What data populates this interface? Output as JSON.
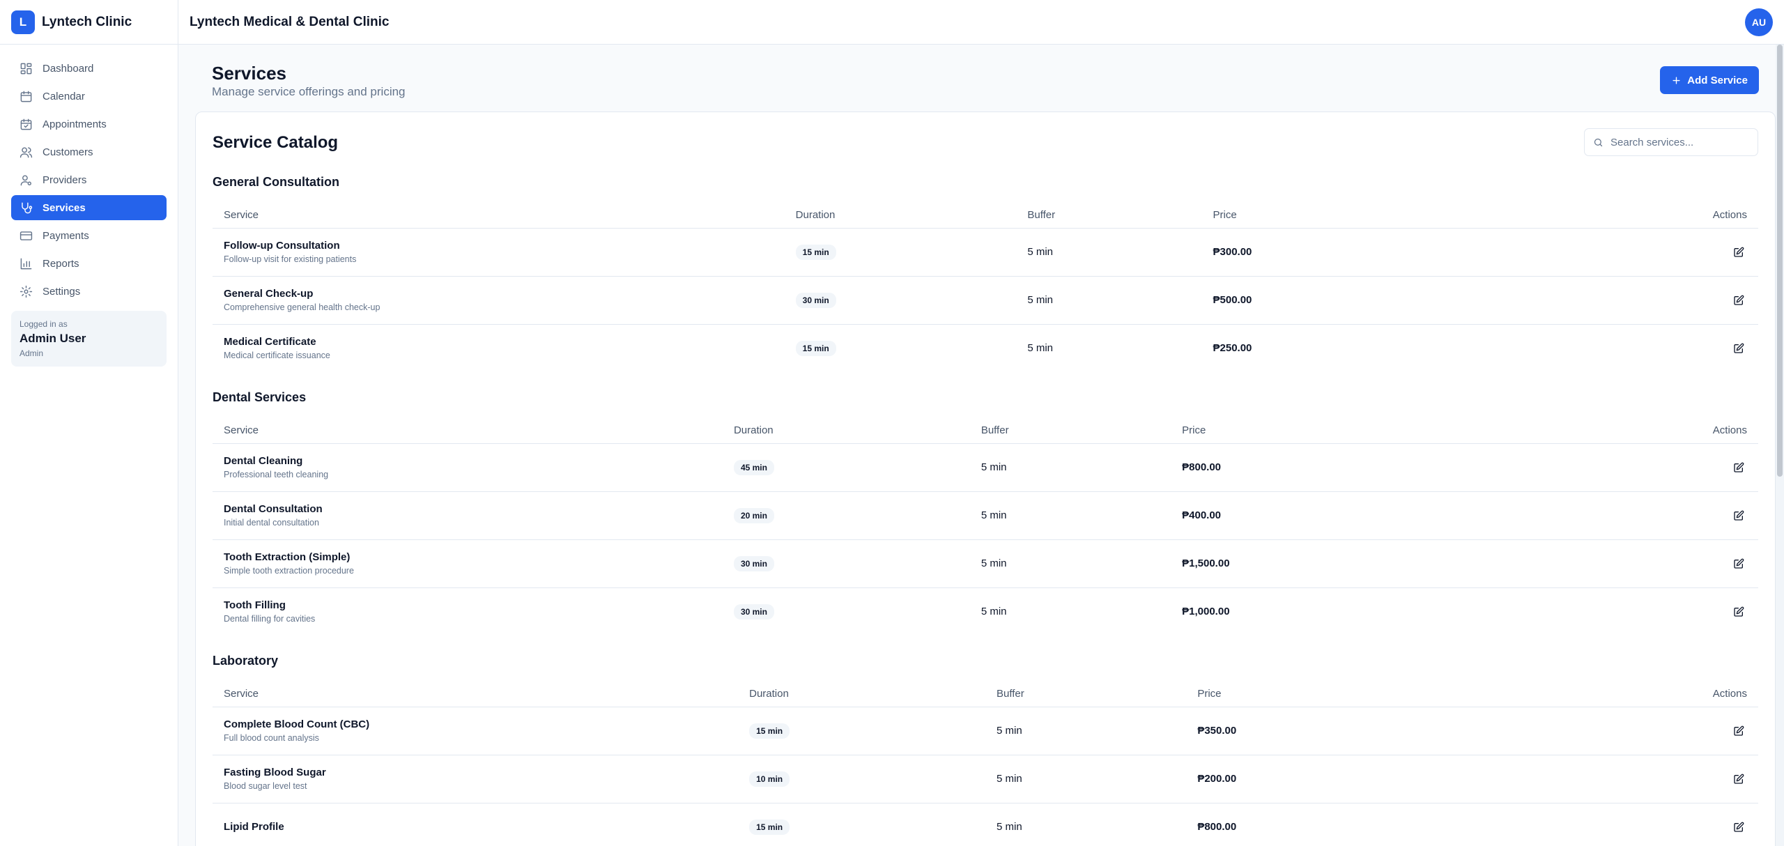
{
  "brand": {
    "logo_letter": "L",
    "name": "Lyntech Clinic"
  },
  "nav": [
    {
      "label": "Dashboard",
      "icon": "dashboard-icon",
      "active": false
    },
    {
      "label": "Calendar",
      "icon": "calendar-icon",
      "active": false
    },
    {
      "label": "Appointments",
      "icon": "appointments-icon",
      "active": false
    },
    {
      "label": "Customers",
      "icon": "customers-icon",
      "active": false
    },
    {
      "label": "Providers",
      "icon": "providers-icon",
      "active": false
    },
    {
      "label": "Services",
      "icon": "stethoscope-icon",
      "active": true
    },
    {
      "label": "Payments",
      "icon": "credit-card-icon",
      "active": false
    },
    {
      "label": "Reports",
      "icon": "bar-chart-icon",
      "active": false
    },
    {
      "label": "Settings",
      "icon": "gear-icon",
      "active": false
    }
  ],
  "user": {
    "caption": "Logged in as",
    "name": "Admin User",
    "role": "Admin"
  },
  "topbar": {
    "title": "Lyntech Medical & Dental Clinic",
    "avatar_initials": "AU"
  },
  "page": {
    "title": "Services",
    "subtitle": "Manage service offerings and pricing",
    "add_button_label": "Add Service"
  },
  "catalog": {
    "title": "Service Catalog",
    "search_placeholder": "Search services...",
    "columns": {
      "service": "Service",
      "duration": "Duration",
      "buffer": "Buffer",
      "price": "Price",
      "actions": "Actions"
    }
  },
  "sections": [
    {
      "title": "General Consultation",
      "rows": [
        {
          "name": "Follow-up Consultation",
          "desc": "Follow-up visit for existing patients",
          "duration": "15 min",
          "buffer": "5 min",
          "price": "₱300.00"
        },
        {
          "name": "General Check-up",
          "desc": "Comprehensive general health check-up",
          "duration": "30 min",
          "buffer": "5 min",
          "price": "₱500.00"
        },
        {
          "name": "Medical Certificate",
          "desc": "Medical certificate issuance",
          "duration": "15 min",
          "buffer": "5 min",
          "price": "₱250.00"
        }
      ]
    },
    {
      "title": "Dental Services",
      "rows": [
        {
          "name": "Dental Cleaning",
          "desc": "Professional teeth cleaning",
          "duration": "45 min",
          "buffer": "5 min",
          "price": "₱800.00"
        },
        {
          "name": "Dental Consultation",
          "desc": "Initial dental consultation",
          "duration": "20 min",
          "buffer": "5 min",
          "price": "₱400.00"
        },
        {
          "name": "Tooth Extraction (Simple)",
          "desc": "Simple tooth extraction procedure",
          "duration": "30 min",
          "buffer": "5 min",
          "price": "₱1,500.00"
        },
        {
          "name": "Tooth Filling",
          "desc": "Dental filling for cavities",
          "duration": "30 min",
          "buffer": "5 min",
          "price": "₱1,000.00"
        }
      ]
    },
    {
      "title": "Laboratory",
      "rows": [
        {
          "name": "Complete Blood Count (CBC)",
          "desc": "Full blood count analysis",
          "duration": "15 min",
          "buffer": "5 min",
          "price": "₱350.00"
        },
        {
          "name": "Fasting Blood Sugar",
          "desc": "Blood sugar level test",
          "duration": "10 min",
          "buffer": "5 min",
          "price": "₱200.00"
        },
        {
          "name": "Lipid Profile",
          "desc": "",
          "duration": "15 min",
          "buffer": "5 min",
          "price": "₱800.00"
        }
      ]
    }
  ],
  "colors": {
    "accent": "#2563eb",
    "muted": "#64748b",
    "border": "#e2e8f0"
  }
}
